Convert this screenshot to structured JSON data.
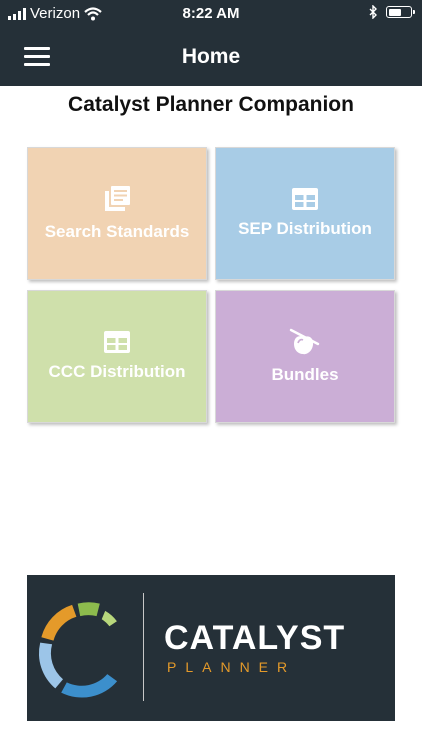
{
  "status": {
    "carrier": "Verizon",
    "time": "8:22 AM",
    "battery_level": 0.5
  },
  "nav": {
    "title": "Home"
  },
  "app": {
    "title": "Catalyst Planner Companion"
  },
  "tiles": [
    {
      "label": "Search Standards",
      "color": "#f1d3b3",
      "icon": "document-list-icon"
    },
    {
      "label": "SEP Distribution",
      "color": "#a8cce6",
      "icon": "grid-table-icon"
    },
    {
      "label": "CCC Distribution",
      "color": "#cfe0ab",
      "icon": "grid-table-icon"
    },
    {
      "label": "Bundles",
      "color": "#cbaed6",
      "icon": "bundle-icon"
    }
  ],
  "footer": {
    "brand_line1": "CATALYST",
    "brand_line2": "PLANNER"
  },
  "colors": {
    "header_bg": "#253038",
    "logo_orange": "#e49a2a",
    "logo_green": "#8dbb4d",
    "logo_light_green": "#b8d77c",
    "logo_light_blue": "#9cc5e8",
    "logo_blue": "#3c8fcc"
  }
}
